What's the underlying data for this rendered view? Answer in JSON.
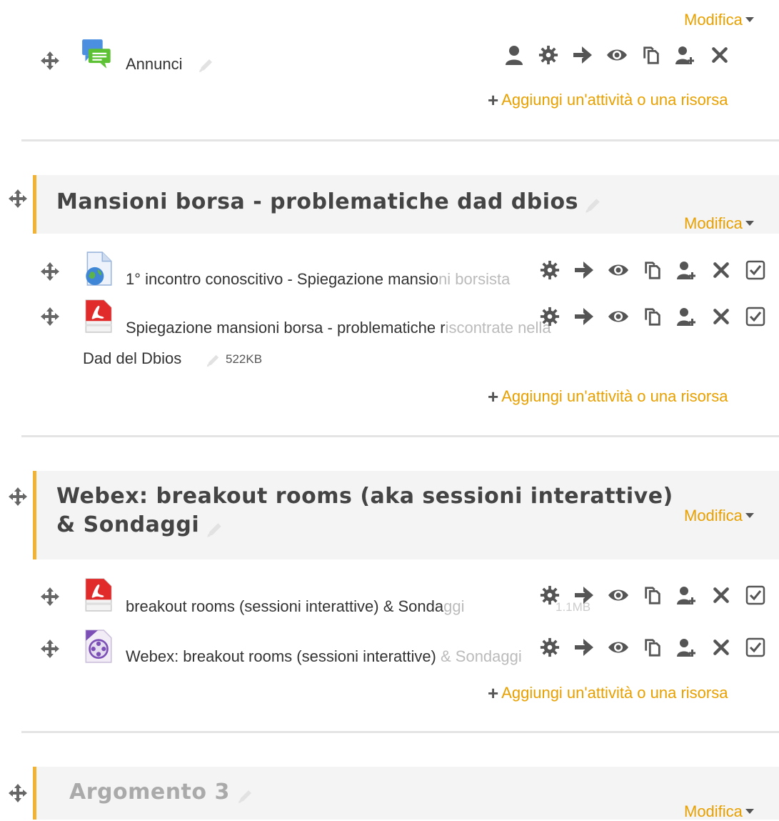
{
  "modifica_label": "Modifica",
  "add_label": "Aggiungi un'attività o una risorsa",
  "top": {
    "activity": {
      "name": "Annunci",
      "icon": "forum-icon"
    }
  },
  "sections": [
    {
      "title": "Mansioni borsa - problematiche dad dbios",
      "activities": [
        {
          "name_main": "1° incontro conoscitivo - Spiegazione mansio",
          "name_fade": "ni borsista",
          "icon": "url-icon"
        },
        {
          "name_main": "Spiegazione mansioni borsa - problematiche r",
          "name_fade": "iscontrate nella",
          "name_line2": "Dad del Dbios",
          "size": "522KB",
          "icon": "pdf-icon"
        }
      ]
    },
    {
      "title_line1": "Webex: breakout rooms (aka sessioni interattive)",
      "title_line2": "& Sondaggi",
      "activities": [
        {
          "name_main": "breakout rooms (sessioni interattive) & Sonda",
          "name_fade": "ggi",
          "size": "1.1MB",
          "icon": "pdf-icon"
        },
        {
          "name_main": "Webex: breakout rooms (sessioni interattive) ",
          "name_fade": "& Sondaggi",
          "icon": "media-icon"
        }
      ]
    },
    {
      "title": "Argomento 3"
    }
  ],
  "colors": {
    "accent": "#e8a000",
    "section_border": "#f2b234",
    "icon_gray": "#555555"
  }
}
